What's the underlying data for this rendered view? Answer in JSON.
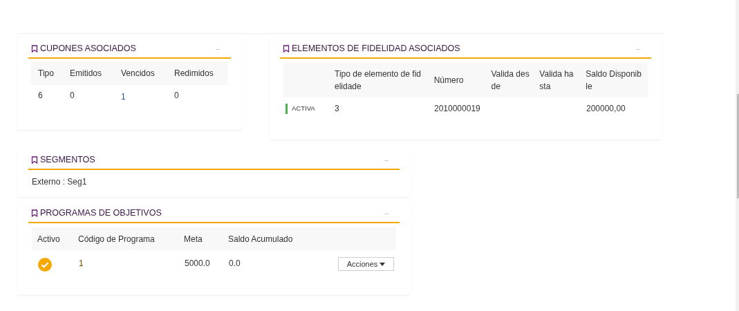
{
  "cupones": {
    "title": "CUPONES ASOCIADOS",
    "collapse": "–",
    "columns": [
      "Tipo",
      "Emitidos",
      "Vencidos",
      "Redimidos"
    ],
    "rows": [
      [
        "6",
        "0",
        "1",
        "0"
      ]
    ]
  },
  "fidelidad": {
    "title": "ELEMENTOS DE FIDELIDAD ASOCIADOS",
    "collapse": "–",
    "columns": [
      "Tipo de elemento de fidelidade",
      "Número",
      "Valida desde",
      "Valida hasta",
      "Saldo Disponible"
    ],
    "rows": [
      {
        "status": "ACTIVA",
        "color": "#4caf50",
        "cells": [
          "3",
          "2010000019",
          "",
          "",
          "200000,00"
        ]
      }
    ]
  },
  "segmentos": {
    "title": "SEGMENTOS",
    "collapse": "–",
    "text": "Externo : Seg1"
  },
  "programas": {
    "title": "PROGRAMAS DE OBJETIVOS",
    "collapse": "–",
    "columns": [
      "Activo",
      "Código de Programa",
      "Meta",
      "Saldo Acumulado"
    ],
    "rows": [
      {
        "active": true,
        "cells": [
          "",
          "1",
          "5000.0",
          "0.0"
        ],
        "action": "Acciones"
      }
    ]
  }
}
